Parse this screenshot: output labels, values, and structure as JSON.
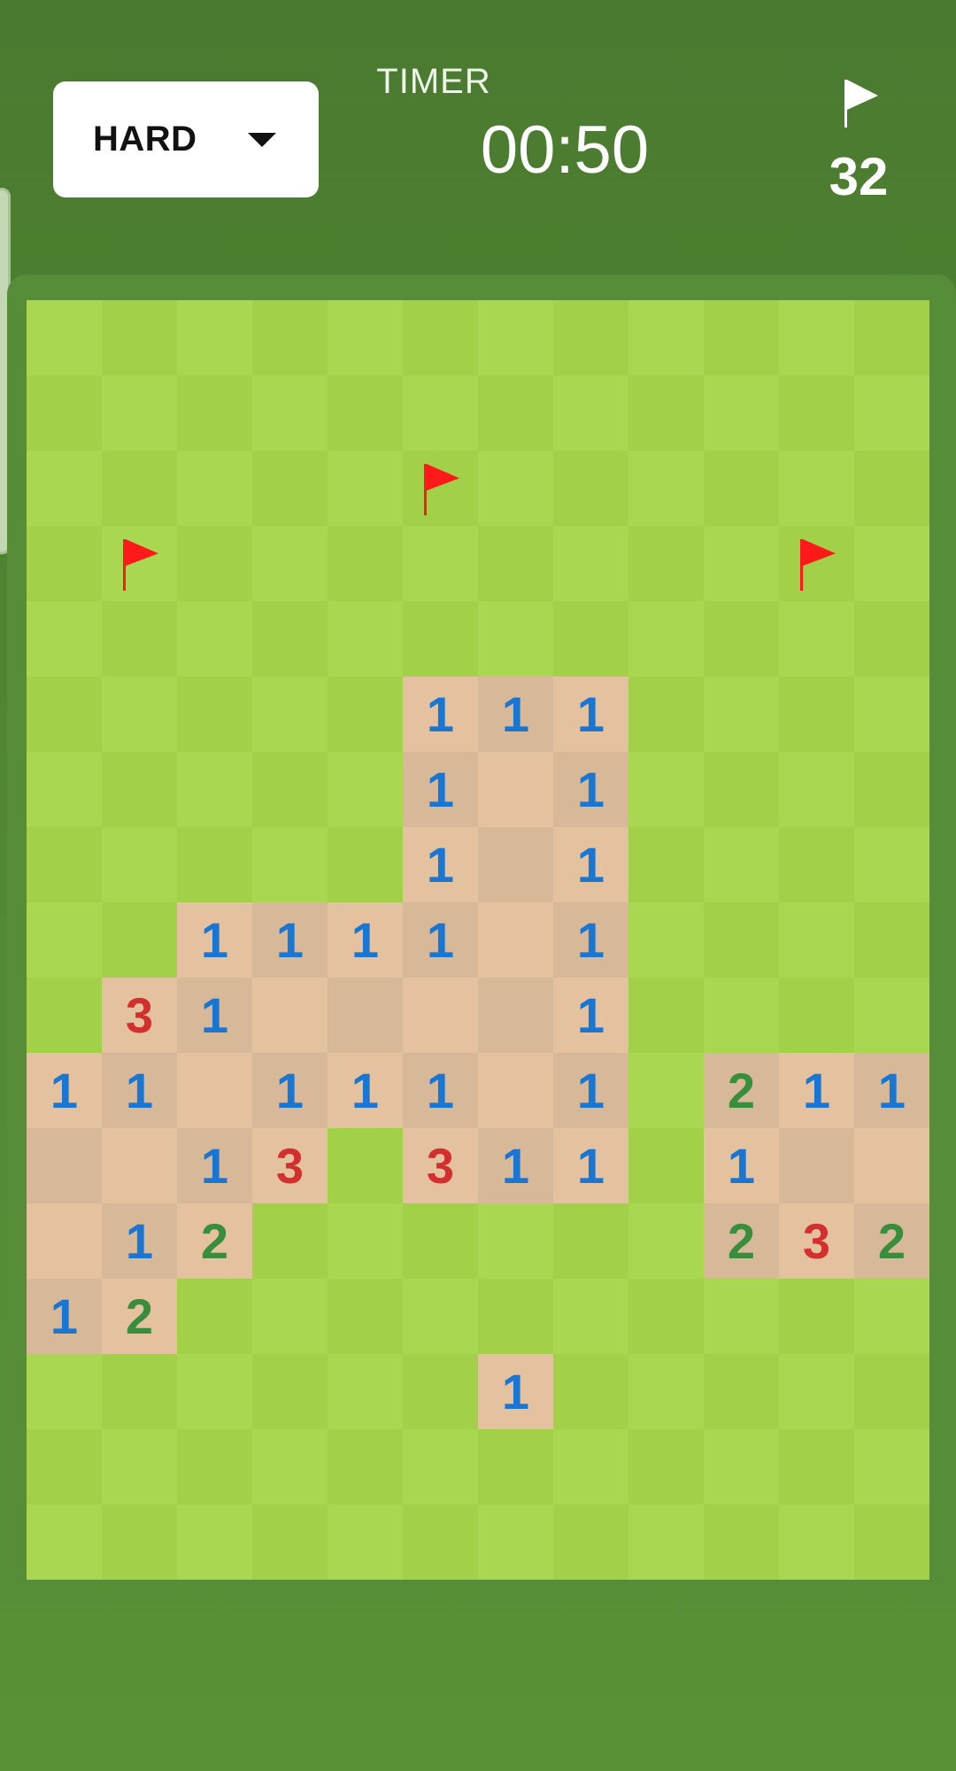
{
  "difficulty": {
    "label": "HARD"
  },
  "timer": {
    "label": "TIMER",
    "value": "00:50"
  },
  "flags": {
    "remaining": "32"
  },
  "colors": {
    "hidden_light": "#a9d751",
    "hidden_dark": "#a2d149",
    "open_light": "#e5c29f",
    "open_dark": "#d7b899",
    "n1": "#1976d2",
    "n2": "#388e3c",
    "n3": "#d32f2f",
    "flag": "#ff1a1a"
  },
  "board": {
    "rows": 17,
    "cols": 12,
    "cells": [
      [
        "H",
        "H",
        "H",
        "H",
        "H",
        "H",
        "H",
        "H",
        "H",
        "H",
        "H",
        "H"
      ],
      [
        "H",
        "H",
        "H",
        "H",
        "H",
        "H",
        "H",
        "H",
        "H",
        "H",
        "H",
        "H"
      ],
      [
        "H",
        "H",
        "H",
        "H",
        "H",
        "F",
        "H",
        "H",
        "H",
        "H",
        "H",
        "H"
      ],
      [
        "H",
        "F",
        "H",
        "H",
        "H",
        "H",
        "H",
        "H",
        "H",
        "H",
        "F",
        "H"
      ],
      [
        "H",
        "H",
        "H",
        "H",
        "H",
        "H",
        "H",
        "H",
        "H",
        "H",
        "H",
        "H"
      ],
      [
        "H",
        "H",
        "H",
        "H",
        "H",
        "1",
        "1",
        "1",
        "H",
        "H",
        "H",
        "H"
      ],
      [
        "H",
        "H",
        "H",
        "H",
        "H",
        "1",
        "0",
        "1",
        "H",
        "H",
        "H",
        "H"
      ],
      [
        "H",
        "H",
        "H",
        "H",
        "H",
        "1",
        "0",
        "1",
        "H",
        "H",
        "H",
        "H"
      ],
      [
        "H",
        "H",
        "1",
        "1",
        "1",
        "1",
        "0",
        "1",
        "H",
        "H",
        "H",
        "H"
      ],
      [
        "H",
        "3",
        "1",
        "0",
        "0",
        "0",
        "0",
        "1",
        "H",
        "H",
        "H",
        "H"
      ],
      [
        "1",
        "1",
        "0",
        "1",
        "1",
        "1",
        "0",
        "1",
        "H",
        "2",
        "1",
        "1"
      ],
      [
        "0",
        "0",
        "1",
        "3",
        "H",
        "3",
        "1",
        "1",
        "H",
        "1",
        "0",
        "0"
      ],
      [
        "0",
        "1",
        "2",
        "H",
        "H",
        "H",
        "H",
        "H",
        "H",
        "2",
        "3",
        "2"
      ],
      [
        "1",
        "2",
        "H",
        "H",
        "H",
        "H",
        "H",
        "H",
        "H",
        "H",
        "H",
        "H"
      ],
      [
        "H",
        "H",
        "H",
        "H",
        "H",
        "H",
        "1",
        "H",
        "H",
        "H",
        "H",
        "H"
      ],
      [
        "H",
        "H",
        "H",
        "H",
        "H",
        "H",
        "H",
        "H",
        "H",
        "H",
        "H",
        "H"
      ],
      [
        "H",
        "H",
        "H",
        "H",
        "H",
        "H",
        "H",
        "H",
        "H",
        "H",
        "H",
        "H"
      ]
    ]
  }
}
